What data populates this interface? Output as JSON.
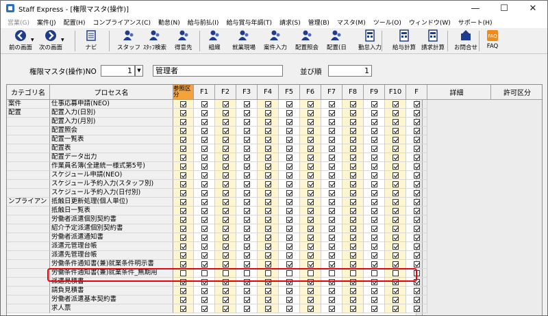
{
  "window": {
    "title": "Staff Express - [権限マスタ(操作)]",
    "controls": [
      "—",
      "☐",
      "✕"
    ]
  },
  "menu": [
    {
      "label": "営業(G)",
      "disabled": true
    },
    {
      "label": "案件(J)",
      "disabled": false
    },
    {
      "label": "配置(H)",
      "disabled": false
    },
    {
      "label": "コンプライアンス(C)",
      "disabled": false
    },
    {
      "label": "勤怠(N)",
      "disabled": false
    },
    {
      "label": "給与前払(I)",
      "disabled": false
    },
    {
      "label": "給与賞与年調(T)",
      "disabled": false
    },
    {
      "label": "請求(S)",
      "disabled": false
    },
    {
      "label": "管理(B)",
      "disabled": false
    },
    {
      "label": "マスタ(M)",
      "disabled": false
    },
    {
      "label": "ツール(O)",
      "disabled": false
    },
    {
      "label": "ウィンドウ(W)",
      "disabled": false
    },
    {
      "label": "サポート(H)",
      "disabled": false
    }
  ],
  "toolbar": [
    {
      "label": "前の画面",
      "icon": "back-icon"
    },
    {
      "label": "次の画面",
      "icon": "forward-icon"
    },
    {
      "label": "ナビ",
      "icon": "navi-icon"
    },
    {
      "label": "スタッフ",
      "icon": "staff-icon"
    },
    {
      "label": "ｽﾀｯﾌ検索",
      "icon": "staff-search-icon"
    },
    {
      "label": "得意先",
      "icon": "customer-icon"
    },
    {
      "label": "組織",
      "icon": "organization-icon"
    },
    {
      "label": "就業現場",
      "icon": "worksite-icon"
    },
    {
      "label": "案件入力",
      "icon": "project-input-icon"
    },
    {
      "label": "配置照会",
      "icon": "placement-inquiry-icon"
    },
    {
      "label": "配置(日",
      "icon": "placement-day-icon"
    },
    {
      "label": "勤怠入力",
      "icon": "attendance-input-icon"
    },
    {
      "label": "給与計算",
      "icon": "payroll-icon"
    },
    {
      "label": "請求計算",
      "icon": "billing-icon"
    },
    {
      "label": "お問合せ",
      "icon": "inquiry-icon"
    },
    {
      "label": "FAQ",
      "icon": "faq-icon"
    }
  ],
  "form": {
    "no_label": "権限マスタ(操作)NO",
    "no_value": "1",
    "name_value": "管理者",
    "order_label": "並び順",
    "order_value": "1"
  },
  "grid": {
    "headers": {
      "category": "カテゴリ名",
      "process": "プロセス名",
      "reference": "参照区分",
      "fkeys": [
        "F1",
        "F2",
        "F3",
        "F4",
        "F5",
        "F6",
        "F7",
        "F8",
        "F9",
        "F10",
        "F"
      ],
      "detail": "詳細",
      "permission": "許可区分"
    },
    "rows": [
      {
        "category": "案件",
        "process": "仕事応募申請(NEO)",
        "checked": true
      },
      {
        "category": "配置",
        "process": "配置入力(日別)",
        "checked": true
      },
      {
        "category": "",
        "process": "配置入力(月別)",
        "checked": true
      },
      {
        "category": "",
        "process": "配置照会",
        "checked": true
      },
      {
        "category": "",
        "process": "配置一覧表",
        "checked": true
      },
      {
        "category": "",
        "process": "配置表",
        "checked": true
      },
      {
        "category": "",
        "process": "配置データ出力",
        "checked": true
      },
      {
        "category": "",
        "process": "作業員名簿(全建統一様式第5号)",
        "checked": true
      },
      {
        "category": "",
        "process": "スケジュール申請(NEO)",
        "checked": true
      },
      {
        "category": "",
        "process": "スケジュール予約入力(スタッフ別)",
        "checked": true
      },
      {
        "category": "",
        "process": "スケジュール予約入力(日付別)",
        "checked": true
      },
      {
        "category": "ンプライアン",
        "process": "抵触日更新処理(個人単位)",
        "checked": true
      },
      {
        "category": "",
        "process": "抵触日一覧表",
        "checked": true
      },
      {
        "category": "",
        "process": "労働者派遣個別契約書",
        "checked": true
      },
      {
        "category": "",
        "process": "紹介予定派遣個別契約書",
        "checked": true
      },
      {
        "category": "",
        "process": "労働者派遣通知書",
        "checked": true
      },
      {
        "category": "",
        "process": "派遣元管理台帳",
        "checked": true
      },
      {
        "category": "",
        "process": "派遣先管理台帳",
        "checked": true
      },
      {
        "category": "",
        "process": "労働条件通知書(兼)就業条件明示書",
        "checked": true
      },
      {
        "category": "",
        "process": "労働条件通知書(兼)就業条件_無期用",
        "checked": false
      },
      {
        "category": "",
        "process": "派遣見積書",
        "checked": true
      },
      {
        "category": "",
        "process": "請負見積書",
        "checked": true
      },
      {
        "category": "",
        "process": "労働者派遣基本契約書",
        "checked": true
      },
      {
        "category": "",
        "process": "求人票",
        "checked": true
      }
    ]
  }
}
